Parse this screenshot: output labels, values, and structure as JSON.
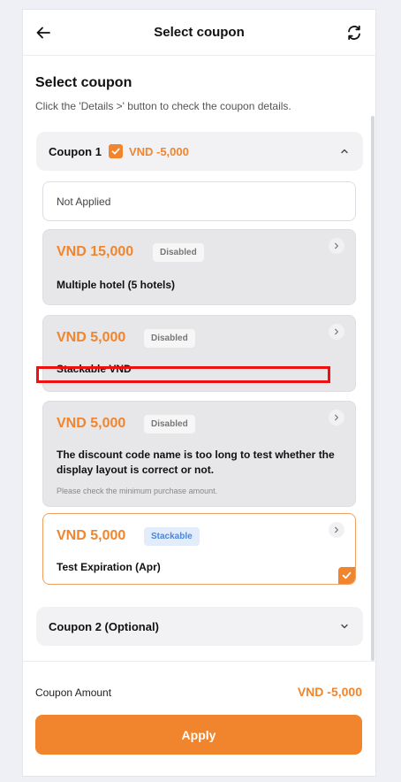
{
  "header": {
    "title": "Select coupon",
    "back_icon": "arrow-left-icon",
    "refresh_icon": "refresh-icon"
  },
  "section": {
    "title": "Select coupon",
    "subtitle": "Click the 'Details >' button to check the coupon details."
  },
  "coupon1": {
    "label": "Coupon 1",
    "amount": "VND -5,000",
    "expanded": true
  },
  "not_applied": "Not Applied",
  "coupons": [
    {
      "price": "VND 15,000",
      "badge": "Disabled",
      "name": "Multiple hotel (5 hotels)",
      "note": "",
      "state": "disabled"
    },
    {
      "price": "VND 5,000",
      "badge": "Disabled",
      "name": "Stackable VND",
      "note": "",
      "state": "disabled"
    },
    {
      "price": "VND 5,000",
      "badge": "Disabled",
      "name": "The discount code name is too long to test whether the display layout is correct or not.",
      "note": "Please check the minimum purchase amount.",
      "state": "disabled"
    },
    {
      "price": "VND 5,000",
      "badge": "Stackable",
      "name": "Test Expiration (Apr)",
      "note": "",
      "state": "selected"
    }
  ],
  "coupon2": {
    "label": "Coupon 2 (Optional)",
    "expanded": false
  },
  "footer": {
    "amount_label": "Coupon Amount",
    "amount_value": "VND -5,000",
    "apply_label": "Apply"
  },
  "colors": {
    "accent": "#f0852e",
    "stackable_badge": "#4d86d6",
    "highlight_box": "#ee1111"
  }
}
